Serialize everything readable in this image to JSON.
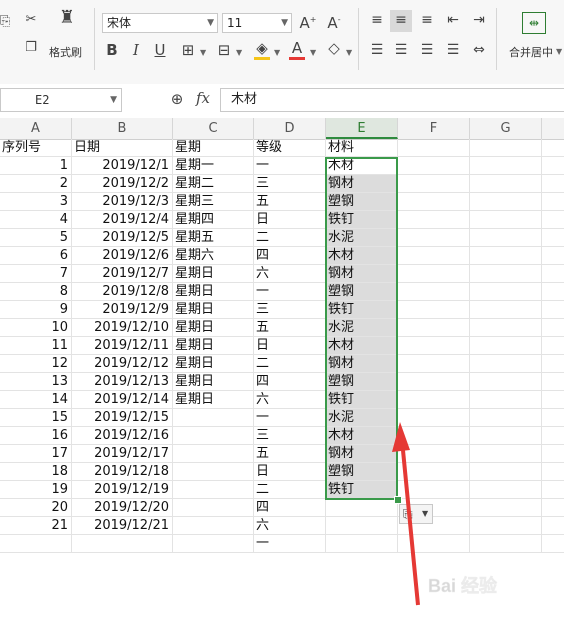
{
  "ribbon": {
    "font_name": "宋体",
    "font_size": "11",
    "format_painter": "格式刷",
    "merge_center": "合并居中",
    "bold": "B",
    "italic": "I",
    "underline": "U",
    "font_color_glyph": "A",
    "increase_font": "A⁺",
    "decrease_font": "A⁻"
  },
  "formula_bar": {
    "name_box": "E2",
    "fx": "fx",
    "value": "木材"
  },
  "columns": [
    "A",
    "B",
    "C",
    "D",
    "E",
    "F",
    "G"
  ],
  "header_row": {
    "a": "序列号",
    "b": "日期",
    "c": "星期",
    "d": "等级",
    "e": "材料"
  },
  "rows": [
    {
      "a": "1",
      "b": "2019/12/1",
      "c": "星期一",
      "d": "一",
      "e": "木材"
    },
    {
      "a": "2",
      "b": "2019/12/2",
      "c": "星期二",
      "d": "三",
      "e": "钢材"
    },
    {
      "a": "3",
      "b": "2019/12/3",
      "c": "星期三",
      "d": "五",
      "e": "塑钢"
    },
    {
      "a": "4",
      "b": "2019/12/4",
      "c": "星期四",
      "d": "日",
      "e": "铁钉"
    },
    {
      "a": "5",
      "b": "2019/12/5",
      "c": "星期五",
      "d": "二",
      "e": "水泥"
    },
    {
      "a": "6",
      "b": "2019/12/6",
      "c": "星期六",
      "d": "四",
      "e": "木材"
    },
    {
      "a": "7",
      "b": "2019/12/7",
      "c": "星期日",
      "d": "六",
      "e": "钢材"
    },
    {
      "a": "8",
      "b": "2019/12/8",
      "c": "星期日",
      "d": "一",
      "e": "塑钢"
    },
    {
      "a": "9",
      "b": "2019/12/9",
      "c": "星期日",
      "d": "三",
      "e": "铁钉"
    },
    {
      "a": "10",
      "b": "2019/12/10",
      "c": "星期日",
      "d": "五",
      "e": "水泥"
    },
    {
      "a": "11",
      "b": "2019/12/11",
      "c": "星期日",
      "d": "日",
      "e": "木材"
    },
    {
      "a": "12",
      "b": "2019/12/12",
      "c": "星期日",
      "d": "二",
      "e": "钢材"
    },
    {
      "a": "13",
      "b": "2019/12/13",
      "c": "星期日",
      "d": "四",
      "e": "塑钢"
    },
    {
      "a": "14",
      "b": "2019/12/14",
      "c": "星期日",
      "d": "六",
      "e": "铁钉"
    },
    {
      "a": "15",
      "b": "2019/12/15",
      "c": "",
      "d": "一",
      "e": "水泥"
    },
    {
      "a": "16",
      "b": "2019/12/16",
      "c": "",
      "d": "三",
      "e": "木材"
    },
    {
      "a": "17",
      "b": "2019/12/17",
      "c": "",
      "d": "五",
      "e": "钢材"
    },
    {
      "a": "18",
      "b": "2019/12/18",
      "c": "",
      "d": "日",
      "e": "塑钢"
    },
    {
      "a": "19",
      "b": "2019/12/19",
      "c": "",
      "d": "二",
      "e": "铁钉"
    },
    {
      "a": "20",
      "b": "2019/12/20",
      "c": "",
      "d": "四",
      "e": ""
    },
    {
      "a": "21",
      "b": "2019/12/21",
      "c": "",
      "d": "六",
      "e": ""
    },
    {
      "a": "",
      "b": "",
      "c": "",
      "d": "一",
      "e": ""
    }
  ],
  "colors": {
    "selection_border": "#3a9a4a",
    "selection_fill": "#dcdcdc",
    "arrow": "#e53935"
  },
  "watermark_text": "Bai 经验"
}
